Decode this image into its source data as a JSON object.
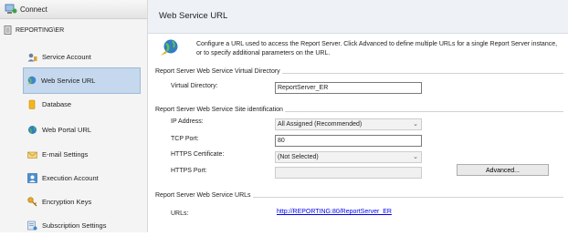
{
  "sidebar": {
    "connect_label": "Connect",
    "server_name": "REPORTING\\ER",
    "items": [
      {
        "label": "Service Account",
        "icon": "service-account-icon"
      },
      {
        "label": "Web Service URL",
        "icon": "web-service-url-icon",
        "selected": true
      },
      {
        "label": "Database",
        "icon": "database-icon"
      },
      {
        "label": "Web Portal URL",
        "icon": "web-portal-icon"
      },
      {
        "label": "E-mail Settings",
        "icon": "email-icon"
      },
      {
        "label": "Execution Account",
        "icon": "execution-account-icon"
      },
      {
        "label": "Encryption Keys",
        "icon": "encryption-keys-icon"
      },
      {
        "label": "Subscription Settings",
        "icon": "subscription-settings-icon"
      }
    ]
  },
  "header": {
    "title": "Web Service URL"
  },
  "description": "Configure a URL used to access the Report Server.  Click Advanced to define multiple URLs for a single Report Server instance, or to specify additional parameters on the URL.",
  "virtual_directory": {
    "group_title": "Report Server Web Service Virtual Directory",
    "label": "Virtual Directory:",
    "value": "ReportServer_ER"
  },
  "site_identification": {
    "group_title": "Report Server Web Service Site identification",
    "ip_label": "IP Address:",
    "ip_value": "All Assigned (Recommended)",
    "tcp_label": "TCP Port:",
    "tcp_value": "80",
    "https_cert_label": "HTTPS Certificate:",
    "https_cert_value": "(Not Selected)",
    "https_port_label": "HTTPS Port:",
    "https_port_value": "",
    "advanced_label": "Advanced..."
  },
  "urls": {
    "group_title": "Report Server Web Service URLs",
    "label": "URLs:",
    "link": "http://REPORTING:80/ReportServer_ER"
  },
  "colors": {
    "selected_bg": "#c5d8ee",
    "header_bg": "#eef2f7",
    "link": "#0000ee"
  }
}
